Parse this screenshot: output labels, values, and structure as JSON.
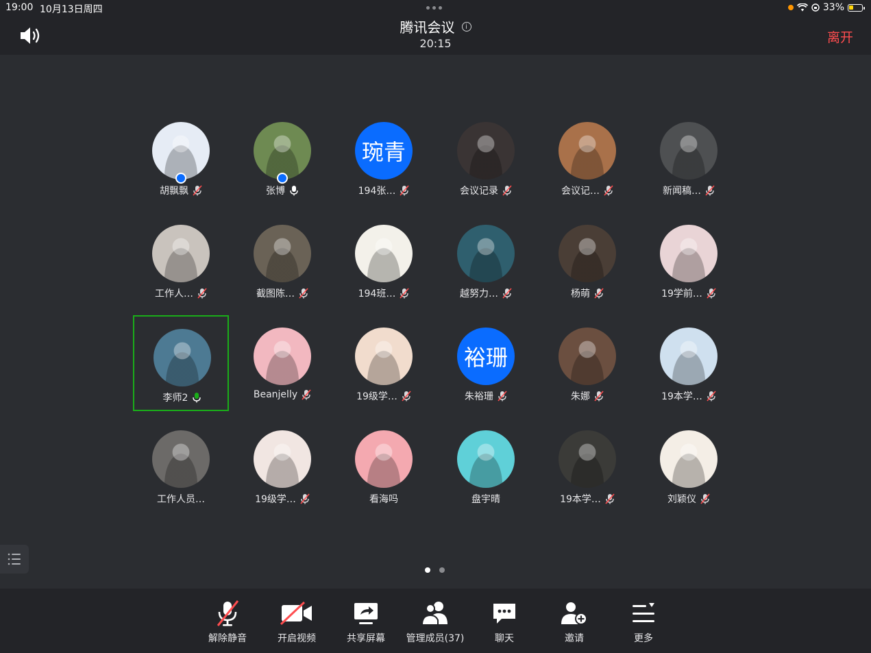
{
  "status_bar": {
    "time": "19:00",
    "date": "10月13日周四",
    "battery": "33%"
  },
  "header": {
    "title": "腾讯会议",
    "elapsed": "20:15",
    "leave_label": "离开"
  },
  "participants": [
    {
      "name": "胡飘飘",
      "mic": "muted",
      "host": true,
      "avatar_color": "#e6ecf5"
    },
    {
      "name": "张博",
      "mic": "on",
      "host": true,
      "avatar_color": "#6e8a52"
    },
    {
      "name": "194张…",
      "mic": "muted",
      "host": false,
      "avatar_text": "琬青",
      "avatar_color": "#0a6cff"
    },
    {
      "name": "会议记录",
      "mic": "muted",
      "host": false,
      "avatar_color": "#3a3434"
    },
    {
      "name": "会议记…",
      "mic": "muted",
      "host": false,
      "avatar_color": "#a9714a"
    },
    {
      "name": "新闻稿…",
      "mic": "muted",
      "host": false,
      "avatar_color": "#4e5052"
    },
    {
      "name": "工作人…",
      "mic": "muted",
      "host": false,
      "avatar_color": "#c9c3bd"
    },
    {
      "name": "截图陈…",
      "mic": "muted",
      "host": false,
      "avatar_color": "#6a6256"
    },
    {
      "name": "194班…",
      "mic": "muted",
      "host": false,
      "avatar_color": "#f3f1ea"
    },
    {
      "name": "越努力…",
      "mic": "muted",
      "host": false,
      "avatar_color": "#2f5f6e"
    },
    {
      "name": "杨萌",
      "mic": "muted",
      "host": false,
      "avatar_color": "#4a3e36"
    },
    {
      "name": "19学前…",
      "mic": "muted",
      "host": false,
      "avatar_color": "#e9d4d6"
    },
    {
      "name": "李师2",
      "mic": "on",
      "host": false,
      "active": true,
      "avatar_color": "#4d7a93"
    },
    {
      "name": "Beanjelly",
      "mic": "muted",
      "host": false,
      "avatar_color": "#f2b8c0"
    },
    {
      "name": "19级学…",
      "mic": "muted",
      "host": false,
      "avatar_color": "#f1dccd"
    },
    {
      "name": "朱裕珊",
      "mic": "muted",
      "host": false,
      "avatar_text": "裕珊",
      "avatar_color": "#0a6cff"
    },
    {
      "name": "朱娜",
      "mic": "muted",
      "host": false,
      "avatar_color": "#6b4f40"
    },
    {
      "name": "19本学…",
      "mic": "muted",
      "host": false,
      "avatar_color": "#cfe0ef"
    },
    {
      "name": "工作人员…",
      "mic": "none",
      "host": false,
      "avatar_color": "#6c6a68"
    },
    {
      "name": "19级学…",
      "mic": "muted",
      "host": false,
      "avatar_color": "#f1e6e2"
    },
    {
      "name": "看海吗",
      "mic": "none",
      "host": false,
      "avatar_color": "#f4a9b0"
    },
    {
      "name": "盘宇晴",
      "mic": "none",
      "host": false,
      "avatar_color": "#5fd0d8"
    },
    {
      "name": "19本学…",
      "mic": "muted",
      "host": false,
      "avatar_color": "#3b3b38"
    },
    {
      "name": "刘颖仪",
      "mic": "muted",
      "host": false,
      "avatar_color": "#f4eee6"
    }
  ],
  "pager": {
    "pages": 2,
    "current": 1
  },
  "toolbar": [
    {
      "label": "解除静音",
      "icon": "mic-off-icon"
    },
    {
      "label": "开启视频",
      "icon": "video-off-icon"
    },
    {
      "label": "共享屏幕",
      "icon": "share-screen-icon"
    },
    {
      "label": "管理成员(37)",
      "icon": "members-icon"
    },
    {
      "label": "聊天",
      "icon": "chat-icon"
    },
    {
      "label": "邀请",
      "icon": "invite-icon"
    },
    {
      "label": "更多",
      "icon": "more-icon"
    }
  ],
  "colors": {
    "accent": "#0a6cff",
    "danger": "#ff4d4f",
    "active_border": "#1aad19",
    "background": "#2b2d31",
    "bar": "#232428"
  }
}
